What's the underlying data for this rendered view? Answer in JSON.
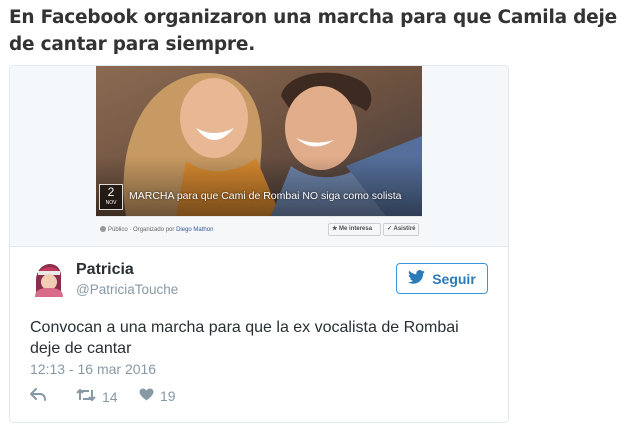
{
  "headline": "En Facebook organizaron una marcha para que Camila deje de cantar para siempre.",
  "event": {
    "date_day": "2",
    "date_month": "NOV",
    "title": "MARCHA para que Cami de Rombai NO siga como solista",
    "meta_privacy": "Público",
    "meta_separator": "·",
    "meta_organizer_label": "Organizado por",
    "meta_organizer": "Diego Mathon",
    "interested_label": "Me interesa",
    "going_label": "Asistiré"
  },
  "tweet": {
    "author_name": "Patricia",
    "author_handle": "@PatriciaTouche",
    "follow_label": "Seguir",
    "text": "Convocan a una marcha para que la ex vocalista de Rombai deje de cantar",
    "timestamp": "12:13 - 16 mar 2016",
    "retweets": "14",
    "likes": "19"
  },
  "colors": {
    "twitter_blue": "#2b7bb9",
    "muted": "#8899a6",
    "text": "#292f33"
  },
  "icons": {
    "follow": "twitter-bird-icon",
    "reply": "reply-icon",
    "retweet": "retweet-icon",
    "like": "heart-icon"
  }
}
